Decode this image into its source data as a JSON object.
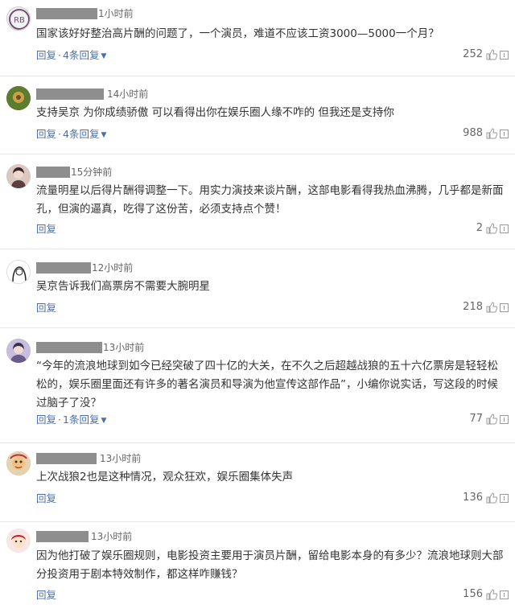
{
  "comments": [
    {
      "time": "1小时前",
      "text": "国家该好好整治高片酬的问题了，一个演员，难道不应该工资3000—5000一个月？",
      "reply_label": "回复",
      "sep": "·",
      "replies_label": "4条回复",
      "likes": "252"
    },
    {
      "time": "14小时前",
      "text": "支持吴京 为你成绩骄傲 可以看得出你在娱乐圈人缘不咋的 但我还是支持你",
      "reply_label": "回复",
      "sep": "·",
      "replies_label": "4条回复",
      "likes": "988"
    },
    {
      "time": "15分钟前",
      "text": "流量明星以后得片酬得调整一下。用实力演技来谈片酬，这部电影看得我热血沸腾，几乎都是新面孔，但演的逼真，吃得了这份苦，必须支持点个赞！",
      "reply_label": "回复",
      "likes": "2"
    },
    {
      "time": "12小时前",
      "text": "吴京告诉我们高票房不需要大腕明星",
      "reply_label": "回复",
      "likes": "218"
    },
    {
      "time": "13小时前",
      "text": "“今年的流浪地球到如今已经突破了四十亿的大关，在不久之后超越战狼的五十六亿票房是轻轻松松的，娱乐圈里面还有许多的著名演员和导演为他宣传这部作品”，小编你说实话，写这段的时候过脑子了没？",
      "reply_label": "回复",
      "sep": "·",
      "replies_label": "1条回复",
      "likes": "77"
    },
    {
      "time": "13小时前",
      "text": "上次战狼2也是这种情况，观众狂欢，娱乐圈集体失声",
      "reply_label": "回复",
      "likes": "136"
    },
    {
      "time": "13小时前",
      "text": "因为他打破了娱乐圈规则，电影投资主要用于演员片酬，留给电影本身的有多少？流浪地球则大部分投资用于剧本特效制作，都这样咋赚钱？",
      "reply_label": "回复",
      "likes": "156"
    }
  ],
  "icons": {
    "like": "thumbs-up-icon",
    "report": "report-icon",
    "expand": "chevron-down-icon"
  },
  "colors": {
    "link": "#4a6fa5",
    "redaction": "#8e8e8e",
    "text": "#333333",
    "meta": "#666666"
  }
}
